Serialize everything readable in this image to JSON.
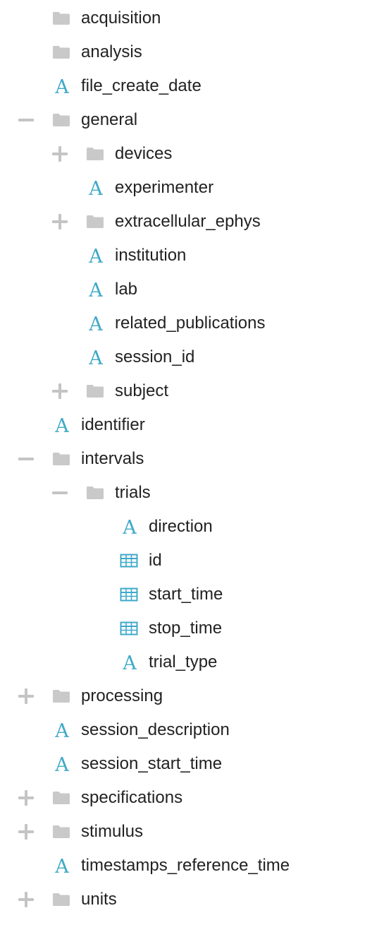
{
  "colors": {
    "folder": "#c9c9c9",
    "toggle": "#c4c4c4",
    "attribute": "#3fa9c8",
    "dataset": "#3fa9c8",
    "text": "#222222"
  },
  "tree": [
    {
      "label": "acquisition",
      "icon": "folder-icon",
      "toggle": "none",
      "depth": 0
    },
    {
      "label": "analysis",
      "icon": "folder-icon",
      "toggle": "none",
      "depth": 0
    },
    {
      "label": "file_create_date",
      "icon": "attribute-icon",
      "toggle": "none",
      "depth": 0
    },
    {
      "label": "general",
      "icon": "folder-icon",
      "toggle": "collapse",
      "depth": 0
    },
    {
      "label": "devices",
      "icon": "folder-icon",
      "toggle": "expand",
      "depth": 1
    },
    {
      "label": "experimenter",
      "icon": "attribute-icon",
      "toggle": "none",
      "depth": 1
    },
    {
      "label": "extracellular_ephys",
      "icon": "folder-icon",
      "toggle": "expand",
      "depth": 1
    },
    {
      "label": "institution",
      "icon": "attribute-icon",
      "toggle": "none",
      "depth": 1
    },
    {
      "label": "lab",
      "icon": "attribute-icon",
      "toggle": "none",
      "depth": 1
    },
    {
      "label": "related_publications",
      "icon": "attribute-icon",
      "toggle": "none",
      "depth": 1
    },
    {
      "label": "session_id",
      "icon": "attribute-icon",
      "toggle": "none",
      "depth": 1
    },
    {
      "label": "subject",
      "icon": "folder-icon",
      "toggle": "expand",
      "depth": 1
    },
    {
      "label": "identifier",
      "icon": "attribute-icon",
      "toggle": "none",
      "depth": 0
    },
    {
      "label": "intervals",
      "icon": "folder-icon",
      "toggle": "collapse",
      "depth": 0
    },
    {
      "label": "trials",
      "icon": "folder-icon",
      "toggle": "collapse",
      "depth": 1
    },
    {
      "label": "direction",
      "icon": "attribute-icon",
      "toggle": "none",
      "depth": 2
    },
    {
      "label": "id",
      "icon": "table-icon",
      "toggle": "none",
      "depth": 2
    },
    {
      "label": "start_time",
      "icon": "table-icon",
      "toggle": "none",
      "depth": 2
    },
    {
      "label": "stop_time",
      "icon": "table-icon",
      "toggle": "none",
      "depth": 2
    },
    {
      "label": "trial_type",
      "icon": "attribute-icon",
      "toggle": "none",
      "depth": 2
    },
    {
      "label": "processing",
      "icon": "folder-icon",
      "toggle": "expand",
      "depth": 0
    },
    {
      "label": "session_description",
      "icon": "attribute-icon",
      "toggle": "none",
      "depth": 0
    },
    {
      "label": "session_start_time",
      "icon": "attribute-icon",
      "toggle": "none",
      "depth": 0
    },
    {
      "label": "specifications",
      "icon": "folder-icon",
      "toggle": "expand",
      "depth": 0
    },
    {
      "label": "stimulus",
      "icon": "folder-icon",
      "toggle": "expand",
      "depth": 0
    },
    {
      "label": "timestamps_reference_time",
      "icon": "attribute-icon",
      "toggle": "none",
      "depth": 0
    },
    {
      "label": "units",
      "icon": "folder-icon",
      "toggle": "expand",
      "depth": 0
    }
  ]
}
